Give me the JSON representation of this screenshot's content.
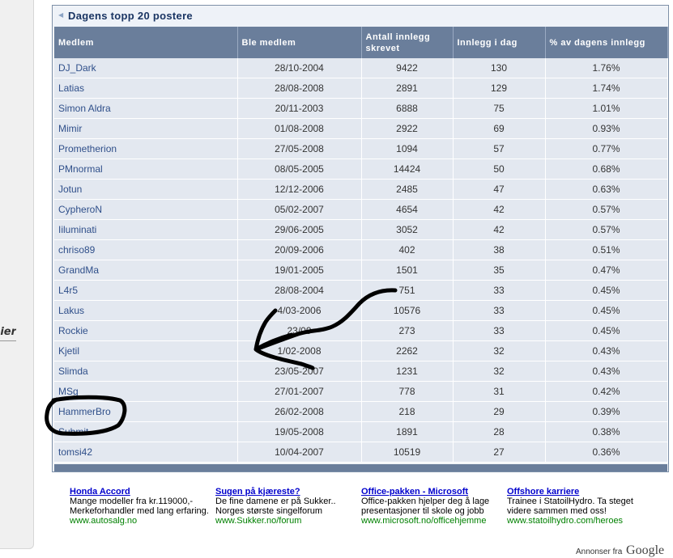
{
  "sidebar": {
    "clipped_text": "ier"
  },
  "box": {
    "title": "Dagens topp 20 postere",
    "title_icon": "bullet-icon"
  },
  "table": {
    "headers": [
      "Medlem",
      "Ble medlem",
      "Antall innlegg skrevet",
      "Innlegg i dag",
      "% av dagens innlegg"
    ],
    "rows": [
      [
        "DJ_Dark",
        "28/10-2004",
        "9422",
        "130",
        "1.76%"
      ],
      [
        "Latias",
        "28/08-2008",
        "2891",
        "129",
        "1.74%"
      ],
      [
        "Simon Aldra",
        "20/11-2003",
        "6888",
        "75",
        "1.01%"
      ],
      [
        "Mimir",
        "01/08-2008",
        "2922",
        "69",
        "0.93%"
      ],
      [
        "Prometherion",
        "27/05-2008",
        "1094",
        "57",
        "0.77%"
      ],
      [
        "PMnormal",
        "08/05-2005",
        "14424",
        "50",
        "0.68%"
      ],
      [
        "Jotun",
        "12/12-2006",
        "2485",
        "47",
        "0.63%"
      ],
      [
        "CypheroN",
        "05/02-2007",
        "4654",
        "42",
        "0.57%"
      ],
      [
        "Iiluminati",
        "29/06-2005",
        "3052",
        "42",
        "0.57%"
      ],
      [
        "chriso89",
        "20/09-2006",
        "402",
        "38",
        "0.51%"
      ],
      [
        "GrandMa",
        "19/01-2005",
        "1501",
        "35",
        "0.47%"
      ],
      [
        "L4r5",
        "28/08-2004",
        "751",
        "33",
        "0.45%"
      ],
      [
        "Lakus",
        "4/03-2006",
        "10576",
        "33",
        "0.45%"
      ],
      [
        "Rockie",
        "23/09",
        "273",
        "33",
        "0.45%"
      ],
      [
        "Kjetil",
        "1/02-2008",
        "2262",
        "32",
        "0.43%"
      ],
      [
        "Slimda",
        "23/05-2007",
        "1231",
        "32",
        "0.43%"
      ],
      [
        "MSg",
        "27/01-2007",
        "778",
        "31",
        "0.42%"
      ],
      [
        "HammerBro",
        "26/02-2008",
        "218",
        "29",
        "0.39%"
      ],
      [
        "Submit",
        "19/05-2008",
        "1891",
        "28",
        "0.38%"
      ],
      [
        "tomsi42",
        "10/04-2007",
        "10519",
        "27",
        "0.36%"
      ]
    ]
  },
  "ads": [
    {
      "title": "Honda Accord",
      "body": "Mange modeller fra kr.119000,- Merkeforhandler med lang erfaring.",
      "url": "www.autosalg.no"
    },
    {
      "title": "Sugen på kjæreste?",
      "body": "De fine damene er på Sukker.. Norges største singelforum",
      "url": "www.Sukker.no/forum"
    },
    {
      "title": "Office-pakken - Microsoft",
      "body": "Office-pakken hjelper deg å lage presentasjoner til skole og jobb",
      "url": "www.microsoft.no/officehjemme"
    },
    {
      "title": "Offshore karriere",
      "body": "Trainee i StatoilHydro. Ta steget videre sammen med oss!",
      "url": "www.statoilhydro.com/heroes"
    }
  ],
  "ads_by": {
    "prefix": "Annonser fra",
    "brand": "Google"
  },
  "annotations": {
    "arrow": "hand-drawn-arrow",
    "circle": "hand-drawn-circle",
    "ink_color": "#000000"
  }
}
